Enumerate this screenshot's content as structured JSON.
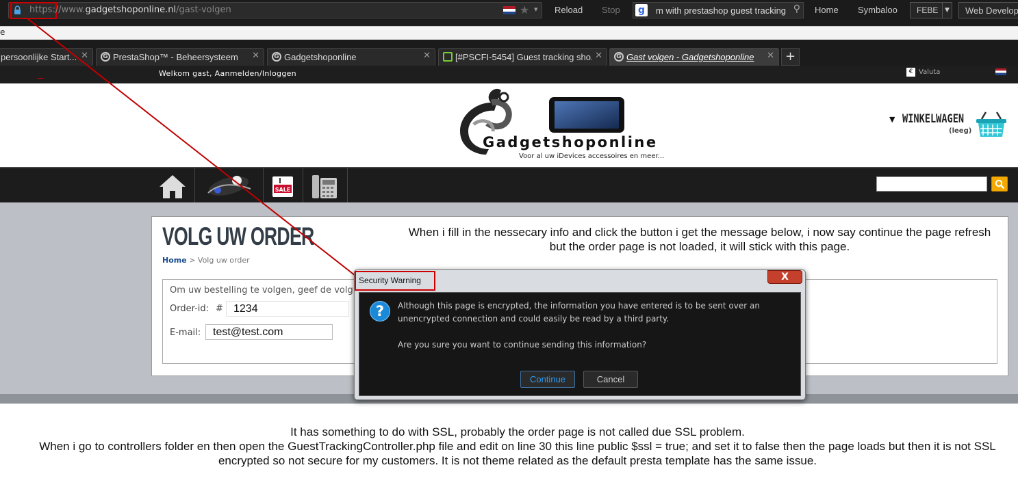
{
  "browser": {
    "url_scheme": "https://",
    "url_www": "www.",
    "url_domain": "gadgetshoponline.nl",
    "url_path": "/gast-volgen",
    "reload_label": "Reload",
    "stop_label": "Stop",
    "search_value": "m with prestashop guest tracking",
    "home_label": "Home",
    "symbaloo_label": "Symbaloo",
    "febe_label": "FEBE",
    "webdev_label": "Web Develop",
    "bookmark_char": "e"
  },
  "tabs": [
    {
      "label": "persoonlijke Start..."
    },
    {
      "label": "PrestaShop™ - Beheersysteem"
    },
    {
      "label": "Gadgetshoponline"
    },
    {
      "label": "[#PSCFI-5454] Guest tracking sho..."
    },
    {
      "label": "Gast volgen - Gadgetshoponline"
    }
  ],
  "site": {
    "welcome": "Welkom gast, Aanmelden/Inloggen",
    "currency_symbol": "€",
    "currency_label": "Valuta",
    "logo_text": "Gadgetshoponline",
    "tagline": "Voor al uw iDevices accessoires en meer...",
    "cart_title": "WINKELWAGEN",
    "cart_status": "(leeg)",
    "sale_label": "SALE"
  },
  "page": {
    "title": "VOLG UW ORDER",
    "breadcrumb_home": "Home",
    "breadcrumb_sep": ">",
    "breadcrumb_current": "Volg uw order",
    "form_intro": "Om uw bestelling te volgen, geef de volg",
    "order_label": "Order-id:",
    "order_hash": "#",
    "order_value": "1234",
    "email_label": "E-mail:",
    "email_value": "test@test.com"
  },
  "notes": {
    "top": "When i fill in the nessecary info and click the button i get the message below, i now say continue the page refresh but the order page is not loaded, it will stick with this page.",
    "bottom_1": "It has something to do with SSL, probably the order page is not called due SSL problem.",
    "bottom_2": "When i go to controllers folder en then open the GuestTrackingController.php file and edit on line 30 this line public $ssl = true; and set it to false then the page loads but then it is not SSL encrypted so not secure for my customers. It is not theme related as the default presta template has the same issue."
  },
  "dialog": {
    "title": "Security Warning",
    "line1": "Although this page is encrypted, the information you have entered is to be sent over an",
    "line2": "unencrypted connection and could easily be read by a third party.",
    "line3": "Are you sure you want to continue sending this information?",
    "continue_label": "Continue",
    "cancel_label": "Cancel",
    "close_glyph": "X"
  },
  "colors": {
    "annotation_red": "#c00000",
    "accent_search": "#f3a900",
    "dialog_link": "#2d9bf0"
  },
  "icons": [
    "lock-icon",
    "flag-nl-icon",
    "star-icon",
    "google-icon",
    "search-icon",
    "home-icon",
    "sale-icon",
    "phone-icon",
    "cart-basket-icon",
    "question-icon"
  ]
}
